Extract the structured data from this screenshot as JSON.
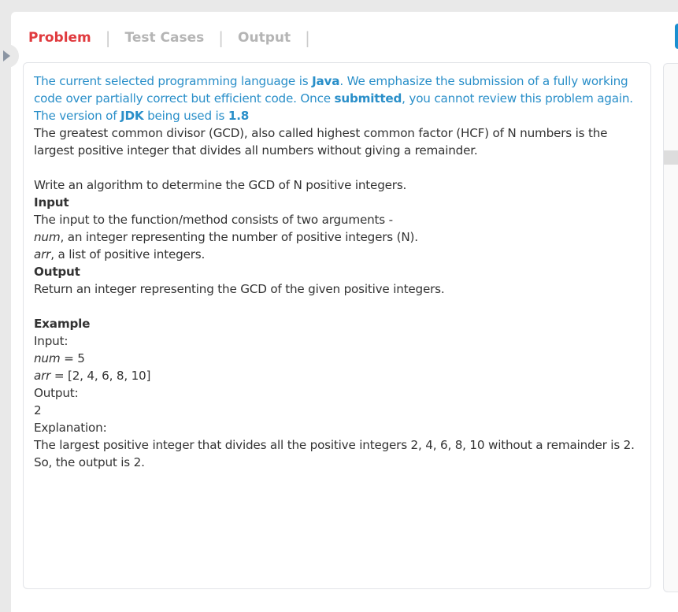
{
  "tabs": [
    "Problem",
    "Test Cases",
    "Output"
  ],
  "notice": {
    "p1": "The current selected programming language is ",
    "lang": "Java",
    "p2": ". We emphasize the submission of a fully working code over partially correct but efficient code. Once ",
    "submitted": "submitted",
    "p3": ", you cannot review this problem again. The version of ",
    "jdk": "JDK",
    "p4": " being used is ",
    "version": "1.8"
  },
  "problem": {
    "intro": "The greatest common divisor (GCD), also called highest common factor (HCF) of N numbers is the largest positive integer that divides all numbers without giving a remainder.",
    "task": "Write an algorithm to determine the GCD of N positive integers.",
    "input_heading": "Input",
    "input_desc": "The input to the function/method consists of two arguments -",
    "arg1_name": "num",
    "arg1_desc": ", an integer representing the number of positive integers (N).",
    "arg2_name": "arr",
    "arg2_desc": ", a list of positive integers.",
    "output_heading": "Output",
    "output_desc": "Return an integer representing the GCD of the given positive integers.",
    "example_heading": "Example",
    "ex_input_label": "Input:",
    "ex_num_name": "num",
    "ex_num_val": " = 5",
    "ex_arr_name": "arr",
    "ex_arr_val": " = [2, 4, 6, 8, 10]",
    "ex_output_label": "Output:",
    "ex_output_val": "2",
    "ex_expl_label": "Explanation:",
    "ex_expl1": "The largest positive integer that divides all the positive integers 2, 4, 6, 8, 10 without a remainder is 2.",
    "ex_expl2": "So, the output is 2."
  }
}
